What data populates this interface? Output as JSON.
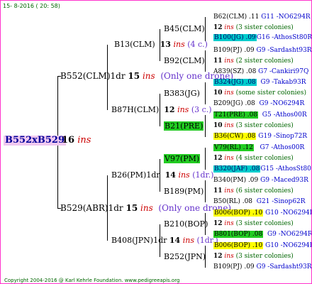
{
  "header": {
    "date": "15- 8-2016 ( 20: 58)"
  },
  "footer": {
    "copyright": "Copyright 2004-2016 @ Karl Kehrle Foundation.   www.pedigreeapis.org"
  },
  "root": {
    "name": "B552xB529",
    "gen": "16",
    "ins": "ins"
  },
  "l1": [
    {
      "name": "B552(CLM)1dr",
      "gen": "15",
      "ins": "ins",
      "note": "(Only one drone)"
    },
    {
      "name": "B529(ABR)1dr",
      "gen": "15",
      "ins": "ins",
      "note": "(Only one drone)"
    }
  ],
  "l2": [
    {
      "name": "B13(CLM)",
      "gen": "13",
      "ins": "ins",
      "note": "(4 c.)"
    },
    {
      "name": "B87H(CLM)",
      "gen": "12",
      "ins": "ins",
      "note": "(3 c.)"
    },
    {
      "name": "B26(PM)1dr",
      "gen": "14",
      "ins": "ins",
      "note": "(1dr.)"
    },
    {
      "name": "B408(JPN)1dr",
      "gen": "14",
      "ins": "ins",
      "note": "(1dr.)"
    }
  ],
  "l3": [
    {
      "name": "B45(CLM)"
    },
    {
      "name": "B92(CLM)"
    },
    {
      "name": "B383(JG)"
    },
    {
      "name": "B21(PRE)"
    },
    {
      "name": "V97(PM)"
    },
    {
      "name": "B189(PM)"
    },
    {
      "name": "B210(BOP)"
    },
    {
      "name": "B252(JPN)"
    }
  ],
  "leaves": [
    {
      "a": "B62(CLM) .11",
      "b": "G11 -NO6294R"
    },
    {
      "gen": "12",
      "ins": "ins",
      "note": "(3 sister colonies)"
    },
    {
      "a": "B100(JG) .09",
      "b": "G16 -AthosSt80R"
    },
    {
      "a": "B109(PJ) .09",
      "b": "G9 -Sardasht93R"
    },
    {
      "gen": "11",
      "ins": "ins",
      "note": "(2 sister colonies)"
    },
    {
      "a": "A839(SZ) .08",
      "b": "G7 -Cankiri97Q"
    },
    {
      "a": "B324(JG) .08",
      "b": "G9 -Takab93R"
    },
    {
      "gen": "10",
      "ins": "ins",
      "note": "(some sister colonies)"
    },
    {
      "a": "B209(JG) .08",
      "b": "G9 -NO6294R"
    },
    {
      "a": "T21(PRE) .08",
      "b": "G5 -Athos00R"
    },
    {
      "gen": "10",
      "ins": "ins",
      "note": "(3 sister colonies)"
    },
    {
      "a": "B36(CW) .08",
      "b": "G19 -Sinop72R"
    },
    {
      "a": "V79(RL) .12",
      "b": "G7 -Athos00R"
    },
    {
      "gen": "12",
      "ins": "ins",
      "note": "(4 sister colonies)"
    },
    {
      "a": "B320(JAF) .08",
      "b": "G15 -AthosSt80R"
    },
    {
      "a": "B340(PM) .09",
      "b": "G9 -Maced93R"
    },
    {
      "gen": "11",
      "ins": "ins",
      "note": "(6 sister colonies)"
    },
    {
      "a": "B50(RL) .08",
      "b": "G21 -Sinop62R"
    },
    {
      "a": "B006(BOP) .10",
      "b": "G10 -NO6294R"
    },
    {
      "gen": "12",
      "ins": "ins",
      "note": "(3 sister colonies)"
    },
    {
      "a": "B801(BOP) .08",
      "b": "G9 -NO6294R"
    },
    {
      "a": "B006(BOP) .10",
      "b": "G10 -NO6294R"
    },
    {
      "gen": "12",
      "ins": "ins",
      "note": "(3 sister colonies)"
    },
    {
      "a": "B109(PJ) .09",
      "b": "G9 -Sardasht93R"
    }
  ],
  "colors": {
    "frame": "#ff33cc",
    "root_bg": "#f0c8f0",
    "cyan": "#00cccc",
    "green": "#22cc22",
    "yellow": "#ffff00"
  }
}
